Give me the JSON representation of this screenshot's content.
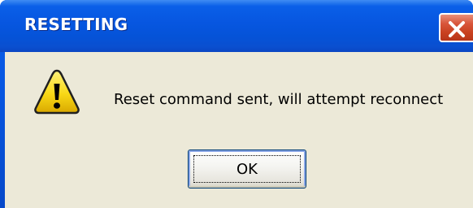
{
  "dialog": {
    "title": "RESETTING",
    "message": "Reset command sent, will attempt reconnect",
    "icon": "warning-icon",
    "ok_label": "OK",
    "close_icon": "close-icon"
  },
  "colors": {
    "titlebar": "#0a5fea",
    "client_background": "#ece9d8",
    "close_button": "#d8553a",
    "warning_yellow": "#f8d816"
  }
}
